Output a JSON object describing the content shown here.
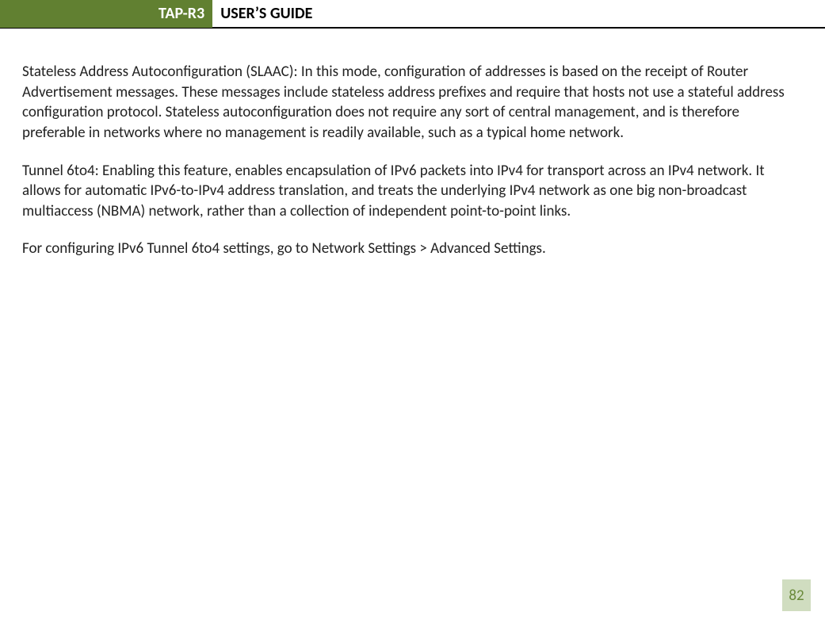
{
  "header": {
    "product_label": "TAP-R3",
    "title": "USER’S GUIDE"
  },
  "content": {
    "paragraphs": [
      "Stateless Address Autoconfiguration (SLAAC): In this mode, configuration of addresses is based on the receipt of Router Advertisement messages. These messages include stateless address prefixes and require that hosts not use a stateful address configuration protocol.  Stateless autoconfiguration does not require any sort of central management, and is therefore preferable in networks where no management is readily available, such as a typical home network.",
      "Tunnel 6to4:  Enabling this feature, enables encapsulation of IPv6 packets into IPv4 for transport across an IPv4 network.  It allows for automatic IPv6-to-IPv4 address translation, and treats the underlying IPv4 network as one big non-broadcast multiaccess (NBMA) network, rather than a collection of independent point-to-point links.",
      "For configuring IPv6 Tunnel 6to4 settings, go to Network Settings > Advanced Settings."
    ]
  },
  "footer": {
    "page_number": "82"
  }
}
